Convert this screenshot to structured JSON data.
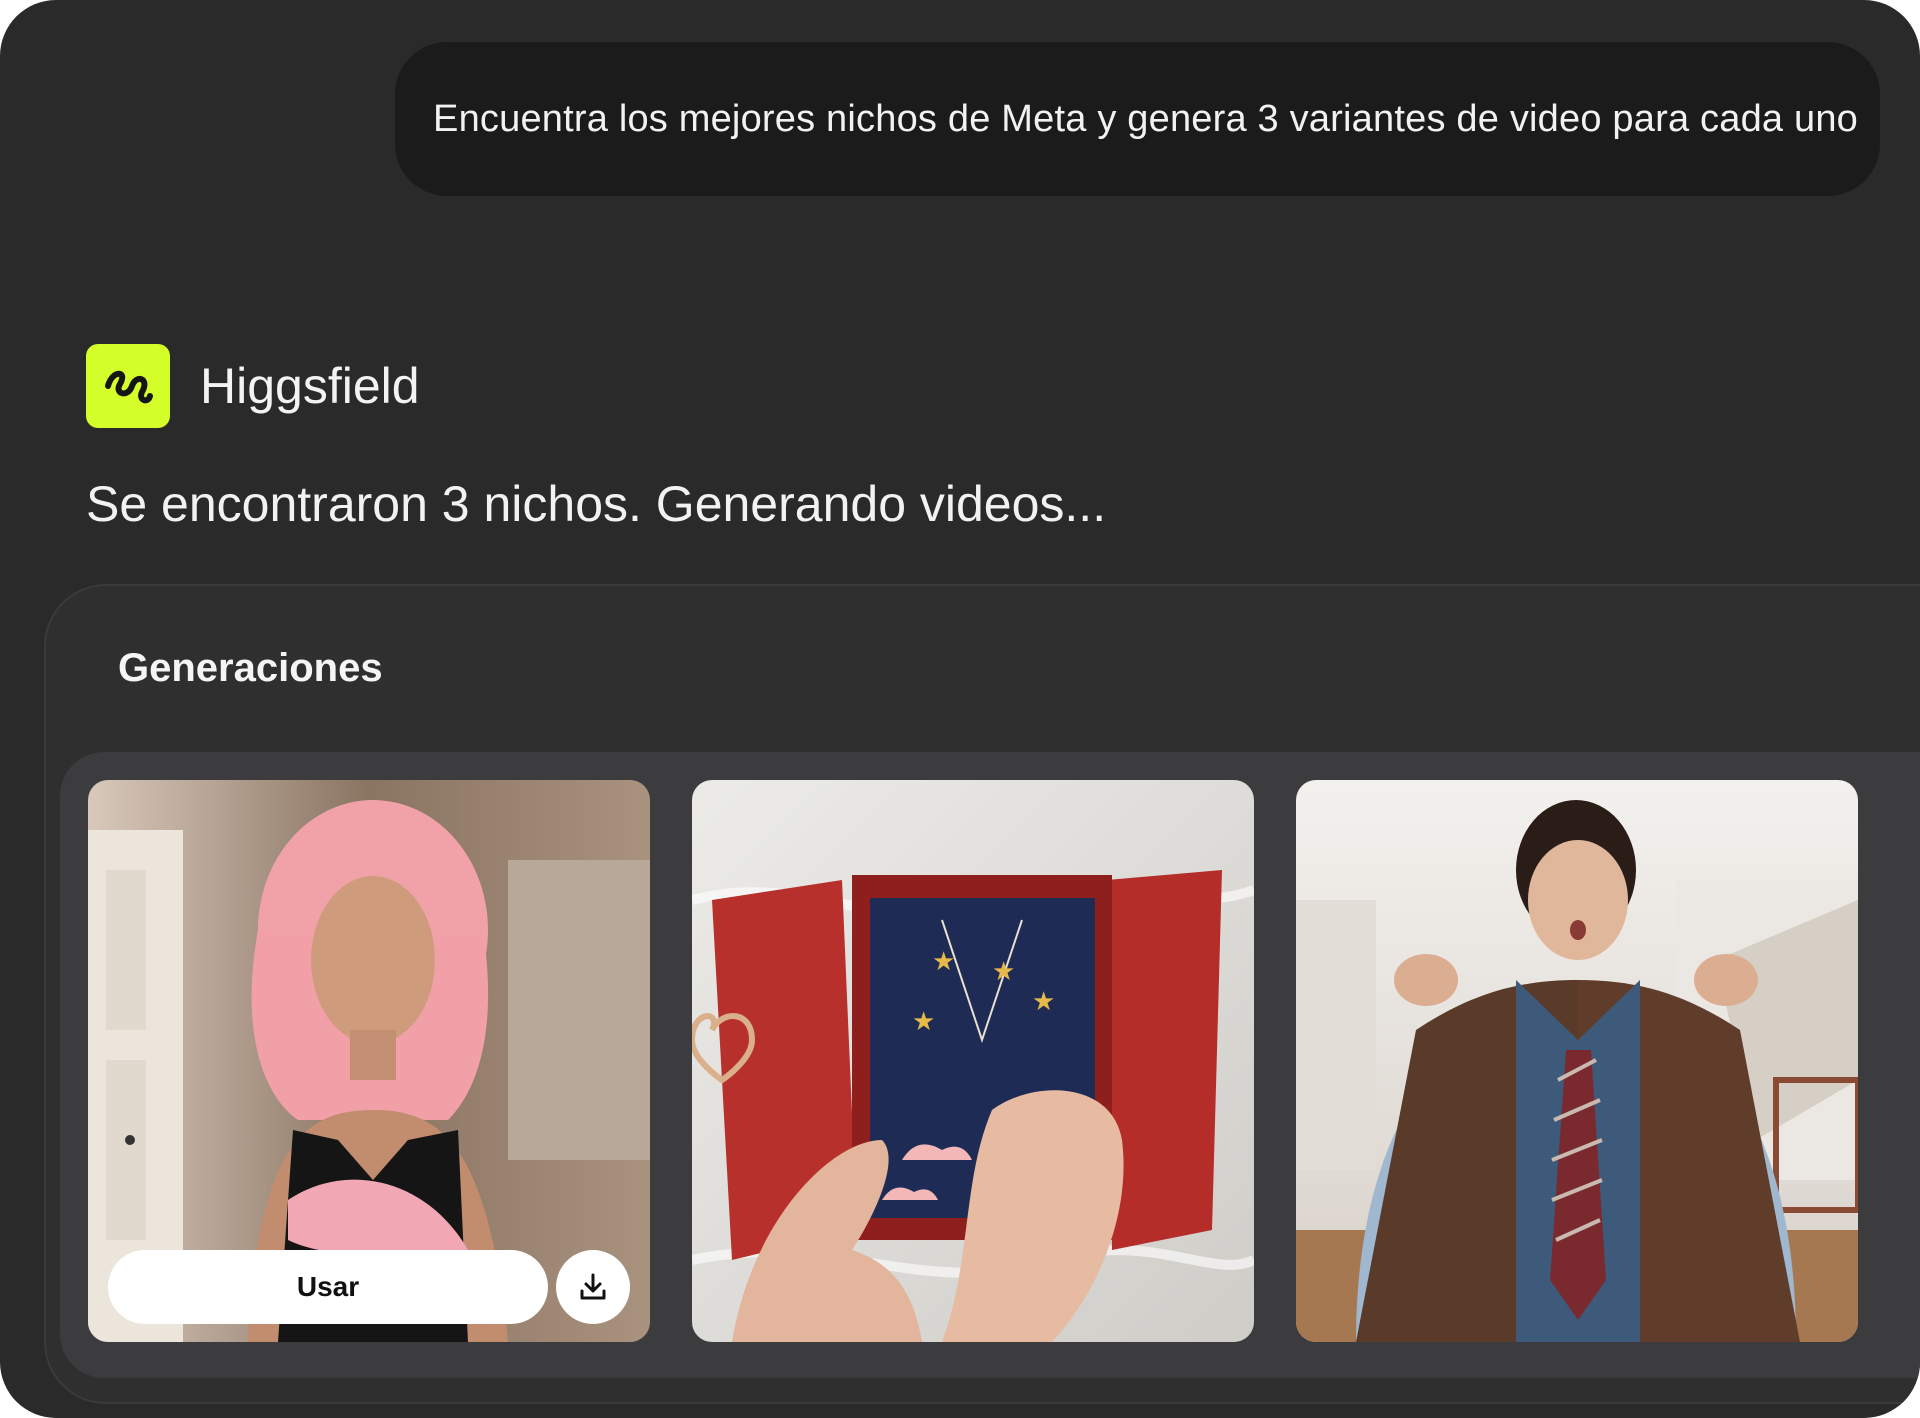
{
  "user_message": {
    "text": "Encuentra los mejores nichos de Meta y genera 3 variantes de video para cada uno"
  },
  "assistant": {
    "name": "Higgsfield",
    "logo_icon": "higgsfield-squiggle-logo",
    "status": "Se encontraron 3 nichos. Generando videos..."
  },
  "generations": {
    "title": "Generaciones",
    "items": [
      {
        "subject": "pink-haired woman with necklace",
        "use_label": "Usar",
        "download_icon": "download-icon"
      },
      {
        "subject": "red jewelry gift box with star necklace"
      },
      {
        "subject": "young man holding leather jacket"
      }
    ]
  },
  "colors": {
    "window_bg": "#2a2a2b",
    "bubble_bg": "#1b1b1c",
    "panel_bg": "#2f2f30",
    "tray_bg": "#3c3c3e",
    "logo_accent": "#d4ff2a"
  }
}
